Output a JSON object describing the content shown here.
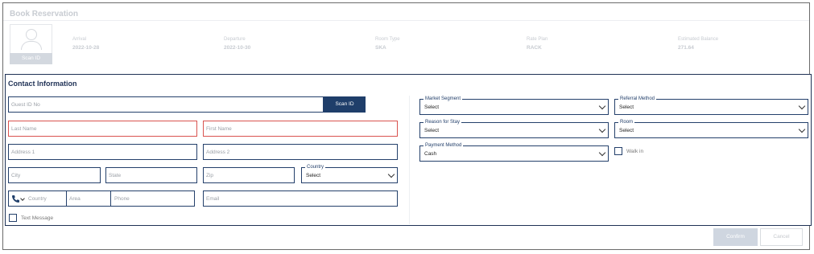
{
  "header": {
    "title": "Book Reservation",
    "scan_id_label": "Scan ID",
    "summary": [
      {
        "label": "Arrival",
        "value": "2022-10-28"
      },
      {
        "label": "Departure",
        "value": "2022-10-30"
      },
      {
        "label": "Room Type",
        "value": "SKA"
      },
      {
        "label": "Rate Plan",
        "value": "RACK"
      },
      {
        "label": "Estimated Balance",
        "value": "271.64"
      }
    ]
  },
  "contact": {
    "title": "Contact Information",
    "guest_id_placeholder": "Guest ID No",
    "scan_id_button": "Scan ID",
    "last_name_placeholder": "Last Name",
    "first_name_placeholder": "First Name",
    "address1_placeholder": "Address 1",
    "address2_placeholder": "Address 2",
    "city_placeholder": "City",
    "state_placeholder": "State",
    "zip_placeholder": "Zip",
    "country_label": "Country",
    "country_value": "Select",
    "phone_country_placeholder": "Country",
    "area_placeholder": "Area",
    "phone_placeholder": "Phone",
    "email_placeholder": "Email",
    "text_message_label": "Text Message"
  },
  "right": {
    "market_segment_label": "Market Segment",
    "market_segment_value": "Select",
    "referral_method_label": "Referral Method",
    "referral_method_value": "Select",
    "reason_for_stay_label": "Reason for Stay",
    "reason_for_stay_value": "Select",
    "room_label": "Room",
    "room_value": "Select",
    "payment_method_label": "Payment Method",
    "payment_method_value": "Cash",
    "walk_in_label": "Walk in"
  },
  "footer": {
    "confirm_label": "Confirm",
    "cancel_label": "Cancel"
  },
  "colors": {
    "primary": "#1f3e6a",
    "error_border": "#d9534f"
  }
}
